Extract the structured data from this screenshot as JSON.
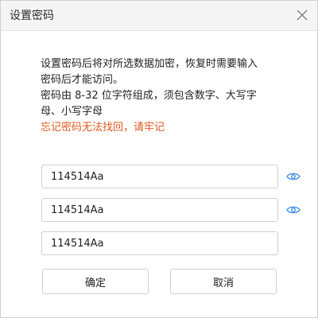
{
  "dialog": {
    "title": "设置密码",
    "close_icon": "close-icon"
  },
  "info": {
    "line1": "设置密码后将对所选数据加密，恢复时需要输入",
    "line2": "密码后才能访问。",
    "line3": "密码由 8-32 位字符组成，须包含数字、大写字",
    "line4": "母、小写字母",
    "warning": "忘记密码无法找回，请牢记",
    "warning_color": "#e0571d"
  },
  "fields": [
    {
      "value": "114514Aa",
      "icon": "eye-icon"
    },
    {
      "value": "114514Aa",
      "icon": "eye-icon"
    },
    {
      "value": "114514Aa"
    }
  ],
  "buttons": {
    "confirm_label": "确定",
    "cancel_label": "取消"
  },
  "colors": {
    "eye_icon": "#3a8ee6"
  }
}
